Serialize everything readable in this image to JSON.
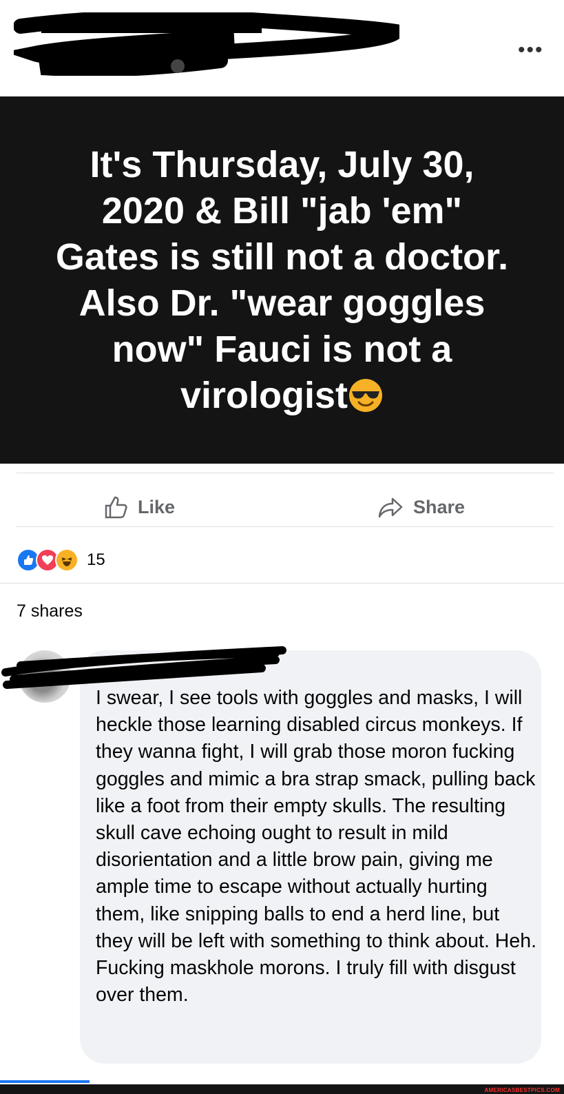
{
  "header": {
    "more_icon": "ellipsis-icon",
    "globe_icon": "globe-icon"
  },
  "post": {
    "text_main": "It's Thursday, July 30, 2020 & Bill \"jab 'em\" Gates is still not a doctor. Also Dr. \"wear goggles now\" Fauci is not a virologist",
    "emoji": "smiling-face-with-sunglasses",
    "background": "#141414"
  },
  "actions": {
    "like_label": "Like",
    "like_icon": "thumbs-up-icon",
    "share_label": "Share",
    "share_icon": "share-arrow-icon"
  },
  "reactions": {
    "types": [
      "like",
      "love",
      "haha"
    ],
    "count": "15"
  },
  "shares": "7 shares",
  "comment": {
    "text": "I swear, I see tools with goggles and masks, I will heckle those learning disabled circus monkeys. If they wanna fight, I will grab those moron fucking goggles and mimic a bra strap smack, pulling back like a foot from their empty skulls. The resulting skull cave echoing ought to result in mild disorientation and a little brow pain, giving me ample time to escape without actually hurting them, like snipping balls to end a herd line, but they will be left with something to think about. Heh. Fucking maskhole morons. I truly fill with disgust over them."
  },
  "watermark": "AMERICASBESTPICS.COM",
  "colors": {
    "accent_blue": "#1877f2",
    "love_red": "#f33e58",
    "haha_yellow": "#f7b125",
    "muted": "#65676b"
  }
}
